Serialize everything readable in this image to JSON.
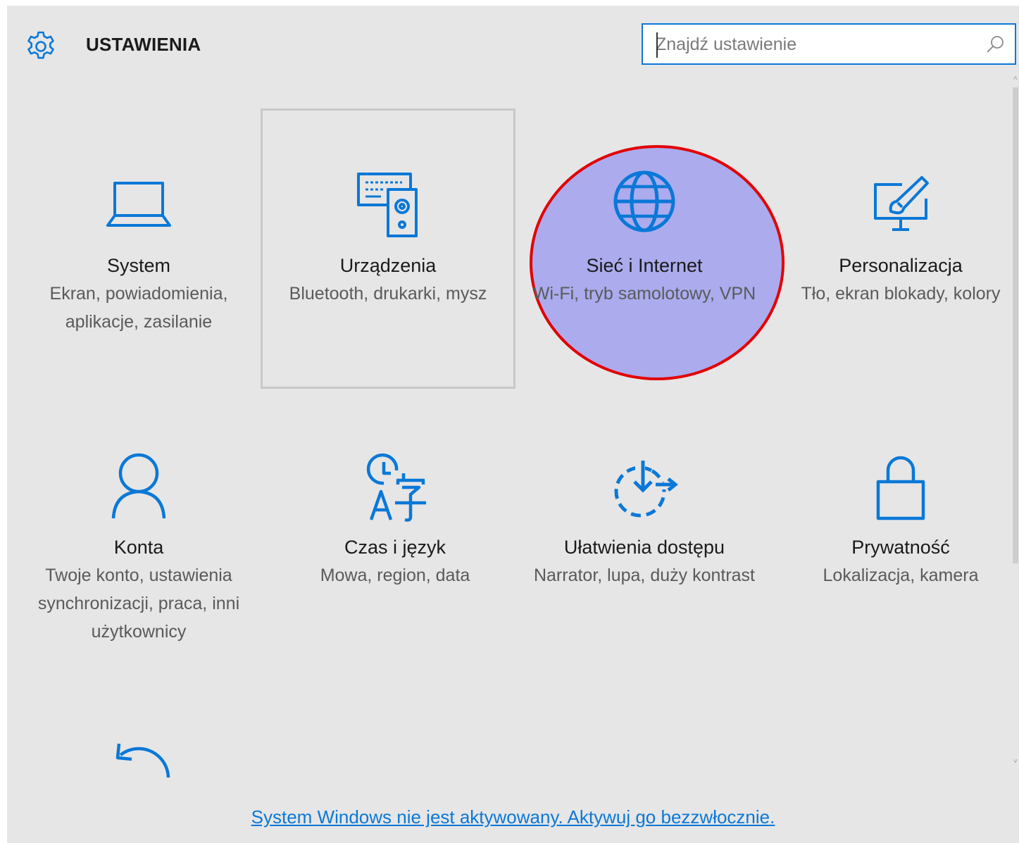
{
  "header": {
    "title": "USTAWIENIA",
    "gear_icon": "gear-icon"
  },
  "search": {
    "placeholder": "Znajdź ustawienie",
    "value": "",
    "icon": "search-icon"
  },
  "accent_color": "#0a78d7",
  "tiles": [
    {
      "name": "System",
      "description": "Ekran, powiadomienia, aplikacje, zasilanie",
      "icon": "laptop-icon"
    },
    {
      "name": "Urządzenia",
      "description": "Bluetooth, drukarki, mysz",
      "icon": "devices-icon",
      "focused": true
    },
    {
      "name": "Sieć i Internet",
      "description": "Wi-Fi, tryb samolotowy, VPN",
      "icon": "globe-icon",
      "highlighted": true
    },
    {
      "name": "Personalizacja",
      "description": "Tło, ekran blokady, kolory",
      "icon": "personalization-icon"
    },
    {
      "name": "Konta",
      "description": "Twoje konto, ustawienia synchronizacji, praca, inni użytkownicy",
      "icon": "person-icon"
    },
    {
      "name": "Czas i język",
      "description": "Mowa, region, data",
      "icon": "time-language-icon"
    },
    {
      "name": "Ułatwienia dostępu",
      "description": "Narrator, lupa, duży kontrast",
      "icon": "ease-of-access-icon"
    },
    {
      "name": "Prywatność",
      "description": "Lokalizacja, kamera",
      "icon": "lock-icon"
    },
    {
      "name": "",
      "description": "",
      "icon": "update-arrow-icon"
    }
  ],
  "activation_link": "System Windows nie jest aktywowany. Aktywuj go bezzwłocznie."
}
